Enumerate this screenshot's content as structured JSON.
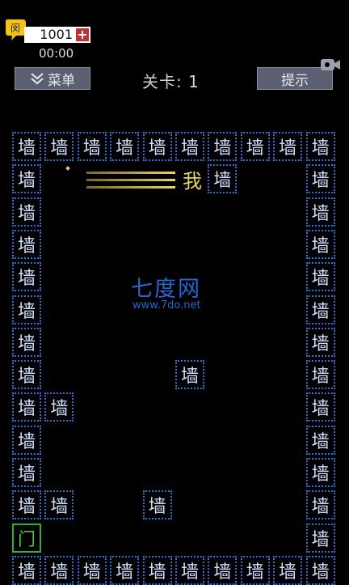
{
  "hud": {
    "coins": "1001",
    "plus": "+",
    "timer": "00:00",
    "badge_char": "闵",
    "level_label": "关卡: 1"
  },
  "buttons": {
    "menu_label": "菜单",
    "hint_label": "提示"
  },
  "board": {
    "wall_char": "墙",
    "door_char": "门",
    "player_char": "我",
    "cols": 10,
    "rows": 14,
    "walls": [
      [
        0,
        0
      ],
      [
        1,
        0
      ],
      [
        2,
        0
      ],
      [
        3,
        0
      ],
      [
        4,
        0
      ],
      [
        5,
        0
      ],
      [
        6,
        0
      ],
      [
        7,
        0
      ],
      [
        8,
        0
      ],
      [
        9,
        0
      ],
      [
        0,
        1
      ],
      [
        6,
        1
      ],
      [
        9,
        1
      ],
      [
        0,
        2
      ],
      [
        9,
        2
      ],
      [
        0,
        3
      ],
      [
        9,
        3
      ],
      [
        0,
        4
      ],
      [
        9,
        4
      ],
      [
        0,
        5
      ],
      [
        9,
        5
      ],
      [
        0,
        6
      ],
      [
        9,
        6
      ],
      [
        0,
        7
      ],
      [
        5,
        7
      ],
      [
        9,
        7
      ],
      [
        0,
        8
      ],
      [
        1,
        8
      ],
      [
        9,
        8
      ],
      [
        0,
        9
      ],
      [
        9,
        9
      ],
      [
        0,
        10
      ],
      [
        9,
        10
      ],
      [
        0,
        11
      ],
      [
        1,
        11
      ],
      [
        4,
        11
      ],
      [
        9,
        11
      ],
      [
        9,
        12
      ],
      [
        0,
        13
      ],
      [
        1,
        13
      ],
      [
        2,
        13
      ],
      [
        3,
        13
      ],
      [
        4,
        13
      ],
      [
        5,
        13
      ],
      [
        6,
        13
      ],
      [
        7,
        13
      ],
      [
        8,
        13
      ],
      [
        9,
        13
      ]
    ],
    "door": [
      0,
      12
    ],
    "player": [
      5,
      1
    ]
  },
  "watermark": {
    "title": "七度网",
    "url": "www.7do.net"
  },
  "colors": {
    "wall": "#2f6fd6",
    "door": "#2fb02f",
    "player": "#e8d36a",
    "button_bg": "#5a6072",
    "watermark": "#2866d0"
  },
  "icons": {
    "menu": "double-chevron-down-icon",
    "video": "video-camera-icon",
    "badge": "speech-bubble-badge-icon"
  }
}
